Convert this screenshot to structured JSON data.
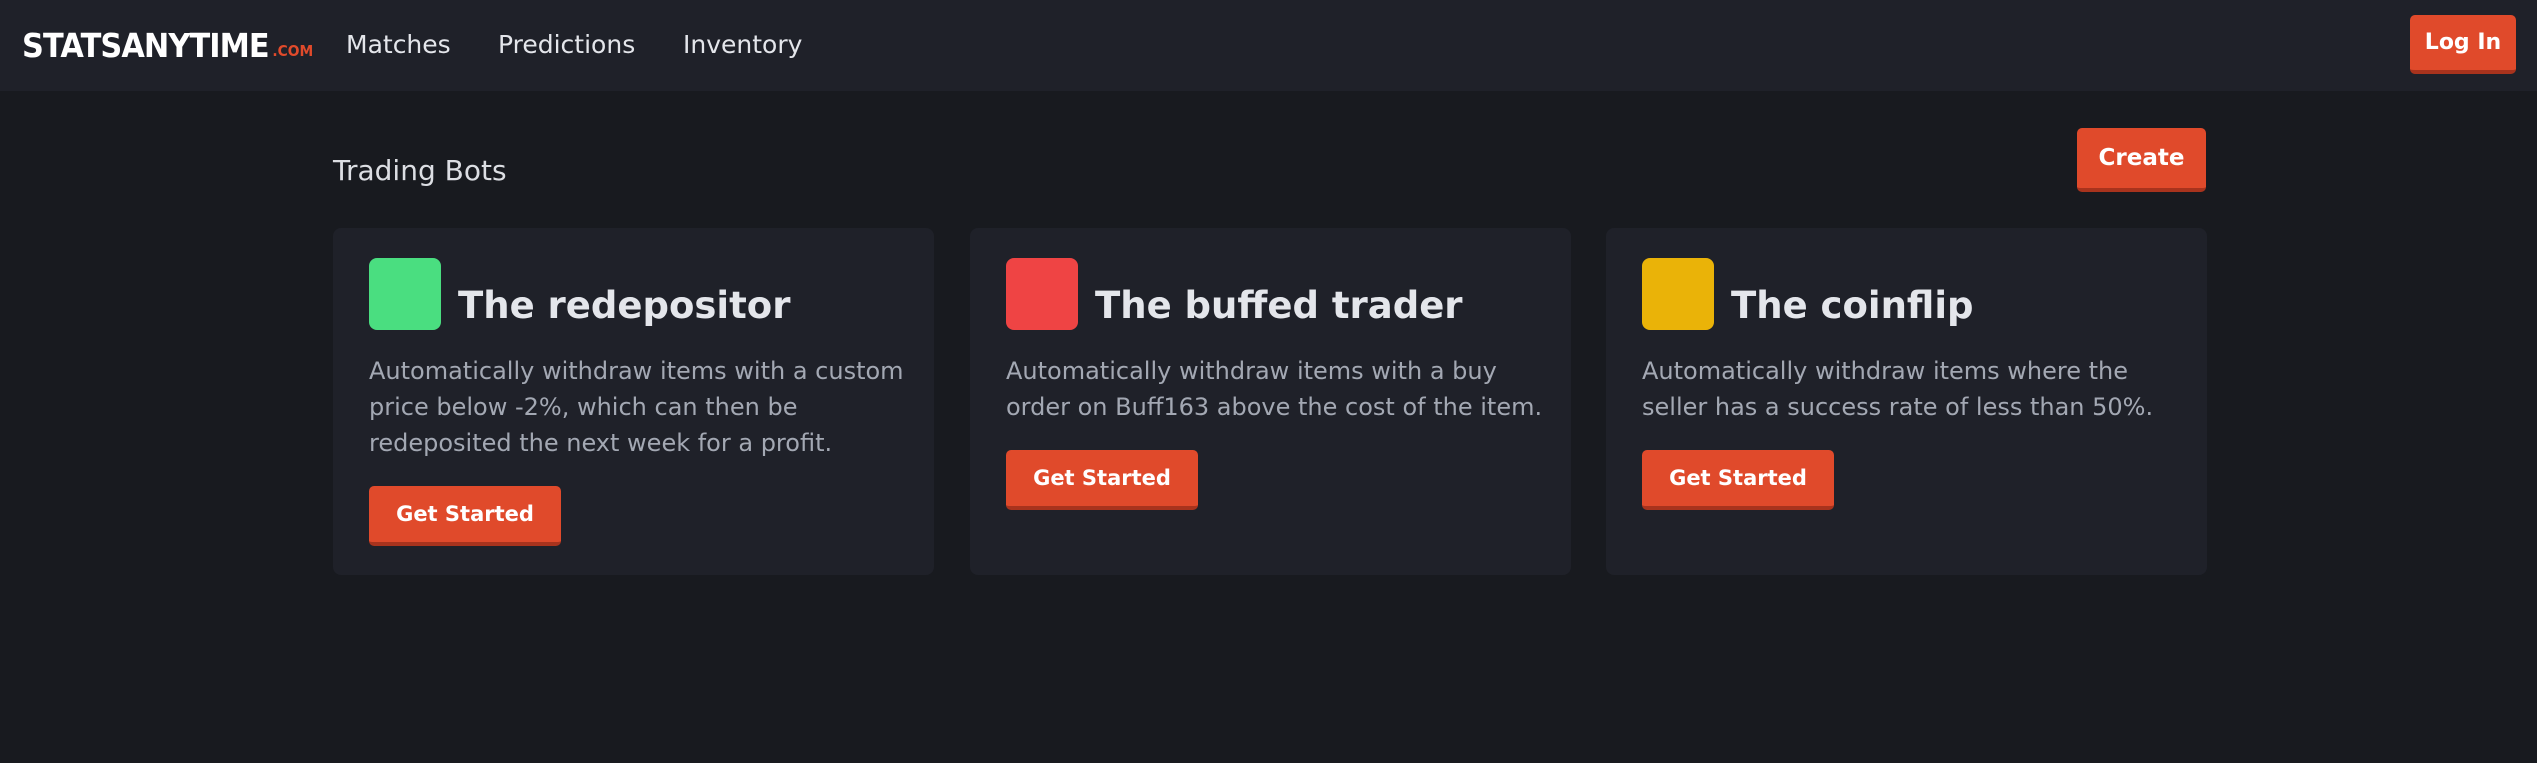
{
  "brand": {
    "name": "STATSANYTIME",
    "suffix": ".COM",
    "accent_color": "#e04a2b"
  },
  "nav": {
    "links": [
      {
        "label": "Matches"
      },
      {
        "label": "Predictions"
      },
      {
        "label": "Inventory"
      }
    ],
    "login_label": "Log In"
  },
  "main": {
    "title": "Trading Bots",
    "create_label": "Create",
    "bots": [
      {
        "name": "The redepositor",
        "description": "Automatically withdraw items with a custom price below -2%, which can then be redeposited the next week for a profit.",
        "color": "#4ade80",
        "cta": "Get Started"
      },
      {
        "name": "The buffed trader",
        "description": "Automatically withdraw items with a buy order on Buff163 above the cost of the item.",
        "color": "#ef4444",
        "cta": "Get Started"
      },
      {
        "name": "The coinflip",
        "description": "Automatically withdraw items where the seller has a success rate of less than 50%.",
        "color": "#eab308",
        "cta": "Get Started"
      }
    ]
  }
}
